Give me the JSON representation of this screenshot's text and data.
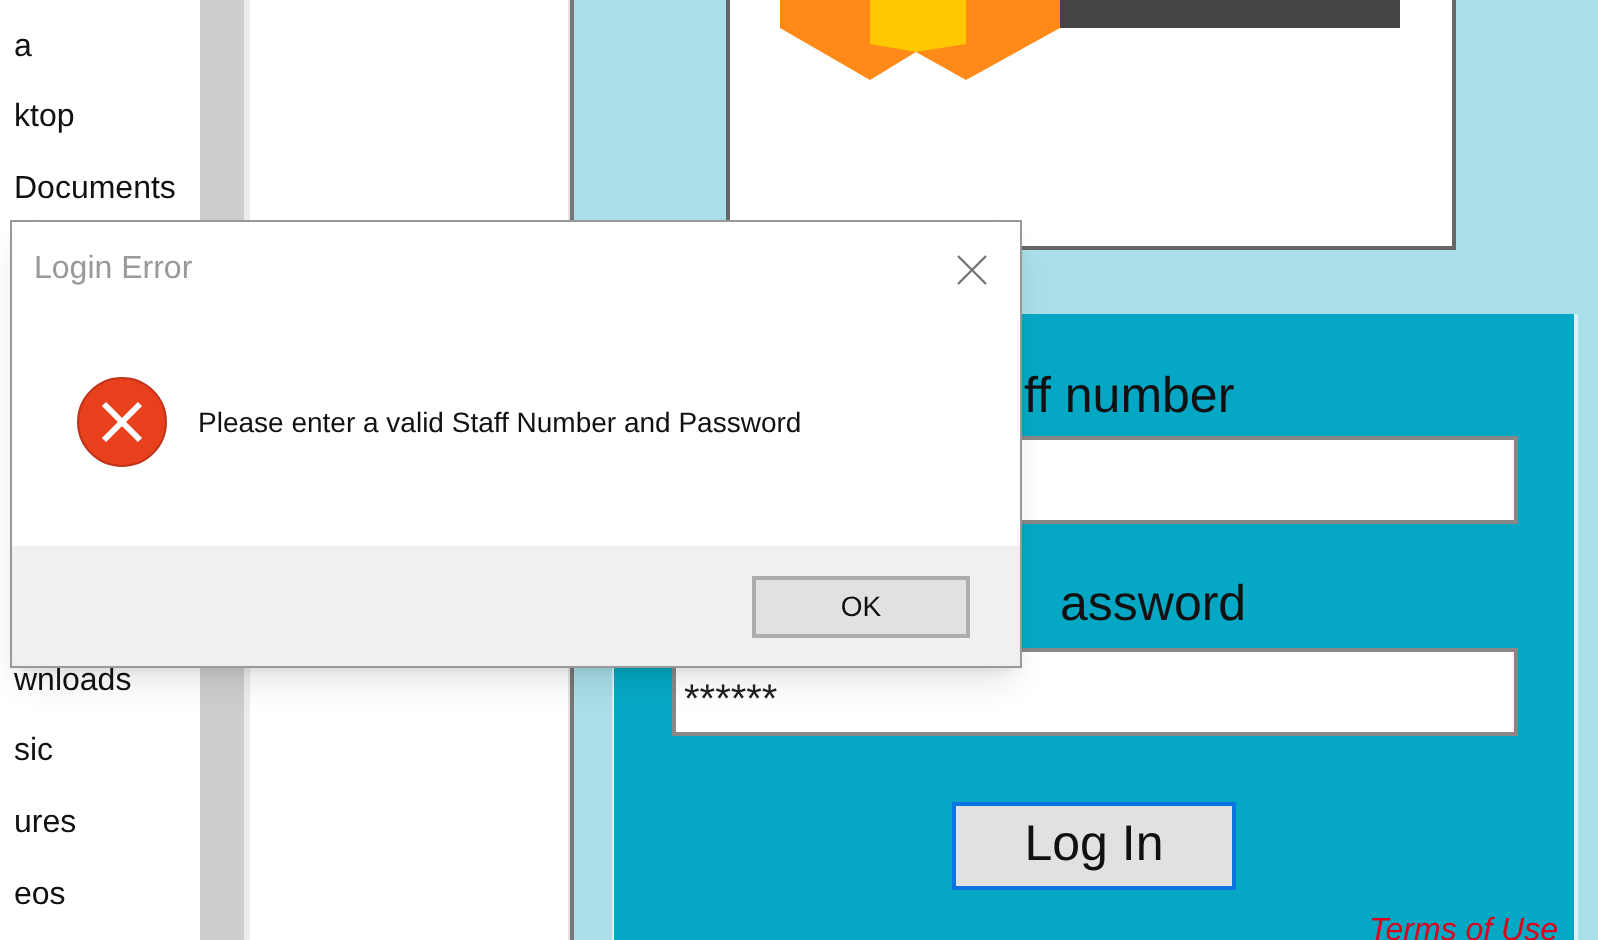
{
  "nav_pane": {
    "items": [
      {
        "label": "a"
      },
      {
        "label": "ktop"
      },
      {
        "label": "Documents"
      },
      {
        "label": "wnloads"
      },
      {
        "label": "sic"
      },
      {
        "label": "ures"
      },
      {
        "label": "eos"
      }
    ]
  },
  "login_window": {
    "staff_label": "ff number",
    "password_label": "assword",
    "password_value": "******",
    "login_button": "Log In",
    "terms_link": "Terms of Use"
  },
  "dialog": {
    "title": "Login Error",
    "message": "Please enter a valid Staff Number and Password",
    "kind": "error",
    "button": "OK"
  }
}
